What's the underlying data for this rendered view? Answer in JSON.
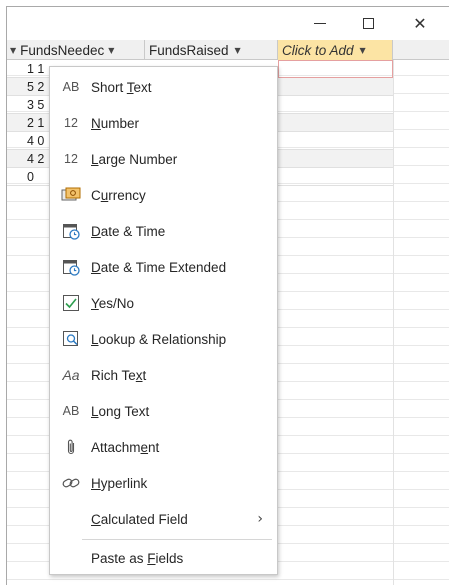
{
  "window": {
    "minimize_glyph": "—",
    "maximize_glyph": "☐",
    "close_glyph": "✕"
  },
  "table": {
    "columns": [
      {
        "label": "FundsNeedec",
        "arrow": "▼"
      },
      {
        "label": "FundsRaised",
        "arrow": "▼"
      },
      {
        "label": "Click to Add",
        "arrow": "▼"
      }
    ],
    "leading_arrow": "▼",
    "rows": [
      "1 1",
      "5 2",
      "3 5",
      "2 1",
      "4 0",
      "4 2",
      "0"
    ]
  },
  "menu": {
    "items": [
      {
        "icon": "AB",
        "icon_name": "short-text-icon",
        "label_pre": "Short ",
        "label_ul": "T",
        "label_post": "ext"
      },
      {
        "icon": "12",
        "icon_name": "number-icon",
        "label_pre": "",
        "label_ul": "N",
        "label_post": "umber"
      },
      {
        "icon": "12",
        "icon_name": "large-number-icon",
        "label_pre": "",
        "label_ul": "L",
        "label_post": "arge Number"
      },
      {
        "icon": "",
        "icon_name": "currency-icon",
        "label_pre": "C",
        "label_ul": "u",
        "label_post": "rrency"
      },
      {
        "icon": "",
        "icon_name": "calendar-icon",
        "label_pre": "",
        "label_ul": "D",
        "label_post": "ate & Time"
      },
      {
        "icon": "",
        "icon_name": "calendar-extended-icon",
        "label_pre": "",
        "label_ul": "D",
        "label_post": "ate & Time Extended"
      },
      {
        "icon": "",
        "icon_name": "checkbox-icon",
        "label_pre": "",
        "label_ul": "Y",
        "label_post": "es/No"
      },
      {
        "icon": "",
        "icon_name": "lookup-icon",
        "label_pre": "",
        "label_ul": "L",
        "label_post": "ookup & Relationship"
      },
      {
        "icon": "Aa",
        "icon_name": "rich-text-icon",
        "label_pre": "Rich Te",
        "label_ul": "x",
        "label_post": "t"
      },
      {
        "icon": "AB",
        "icon_name": "long-text-icon",
        "label_pre": "",
        "label_ul": "L",
        "label_post": "ong Text"
      },
      {
        "icon": "",
        "icon_name": "paperclip-icon",
        "label_pre": "Attachm",
        "label_ul": "e",
        "label_post": "nt"
      },
      {
        "icon": "",
        "icon_name": "hyperlink-icon",
        "label_pre": "",
        "label_ul": "H",
        "label_post": "yperlink"
      },
      {
        "icon": "",
        "icon_name": "",
        "label_pre": "",
        "label_ul": "C",
        "label_post": "alculated Field",
        "chevron": "›"
      },
      {
        "icon": "",
        "icon_name": "",
        "label_pre": "Paste as ",
        "label_ul": "F",
        "label_post": "ields"
      }
    ]
  }
}
